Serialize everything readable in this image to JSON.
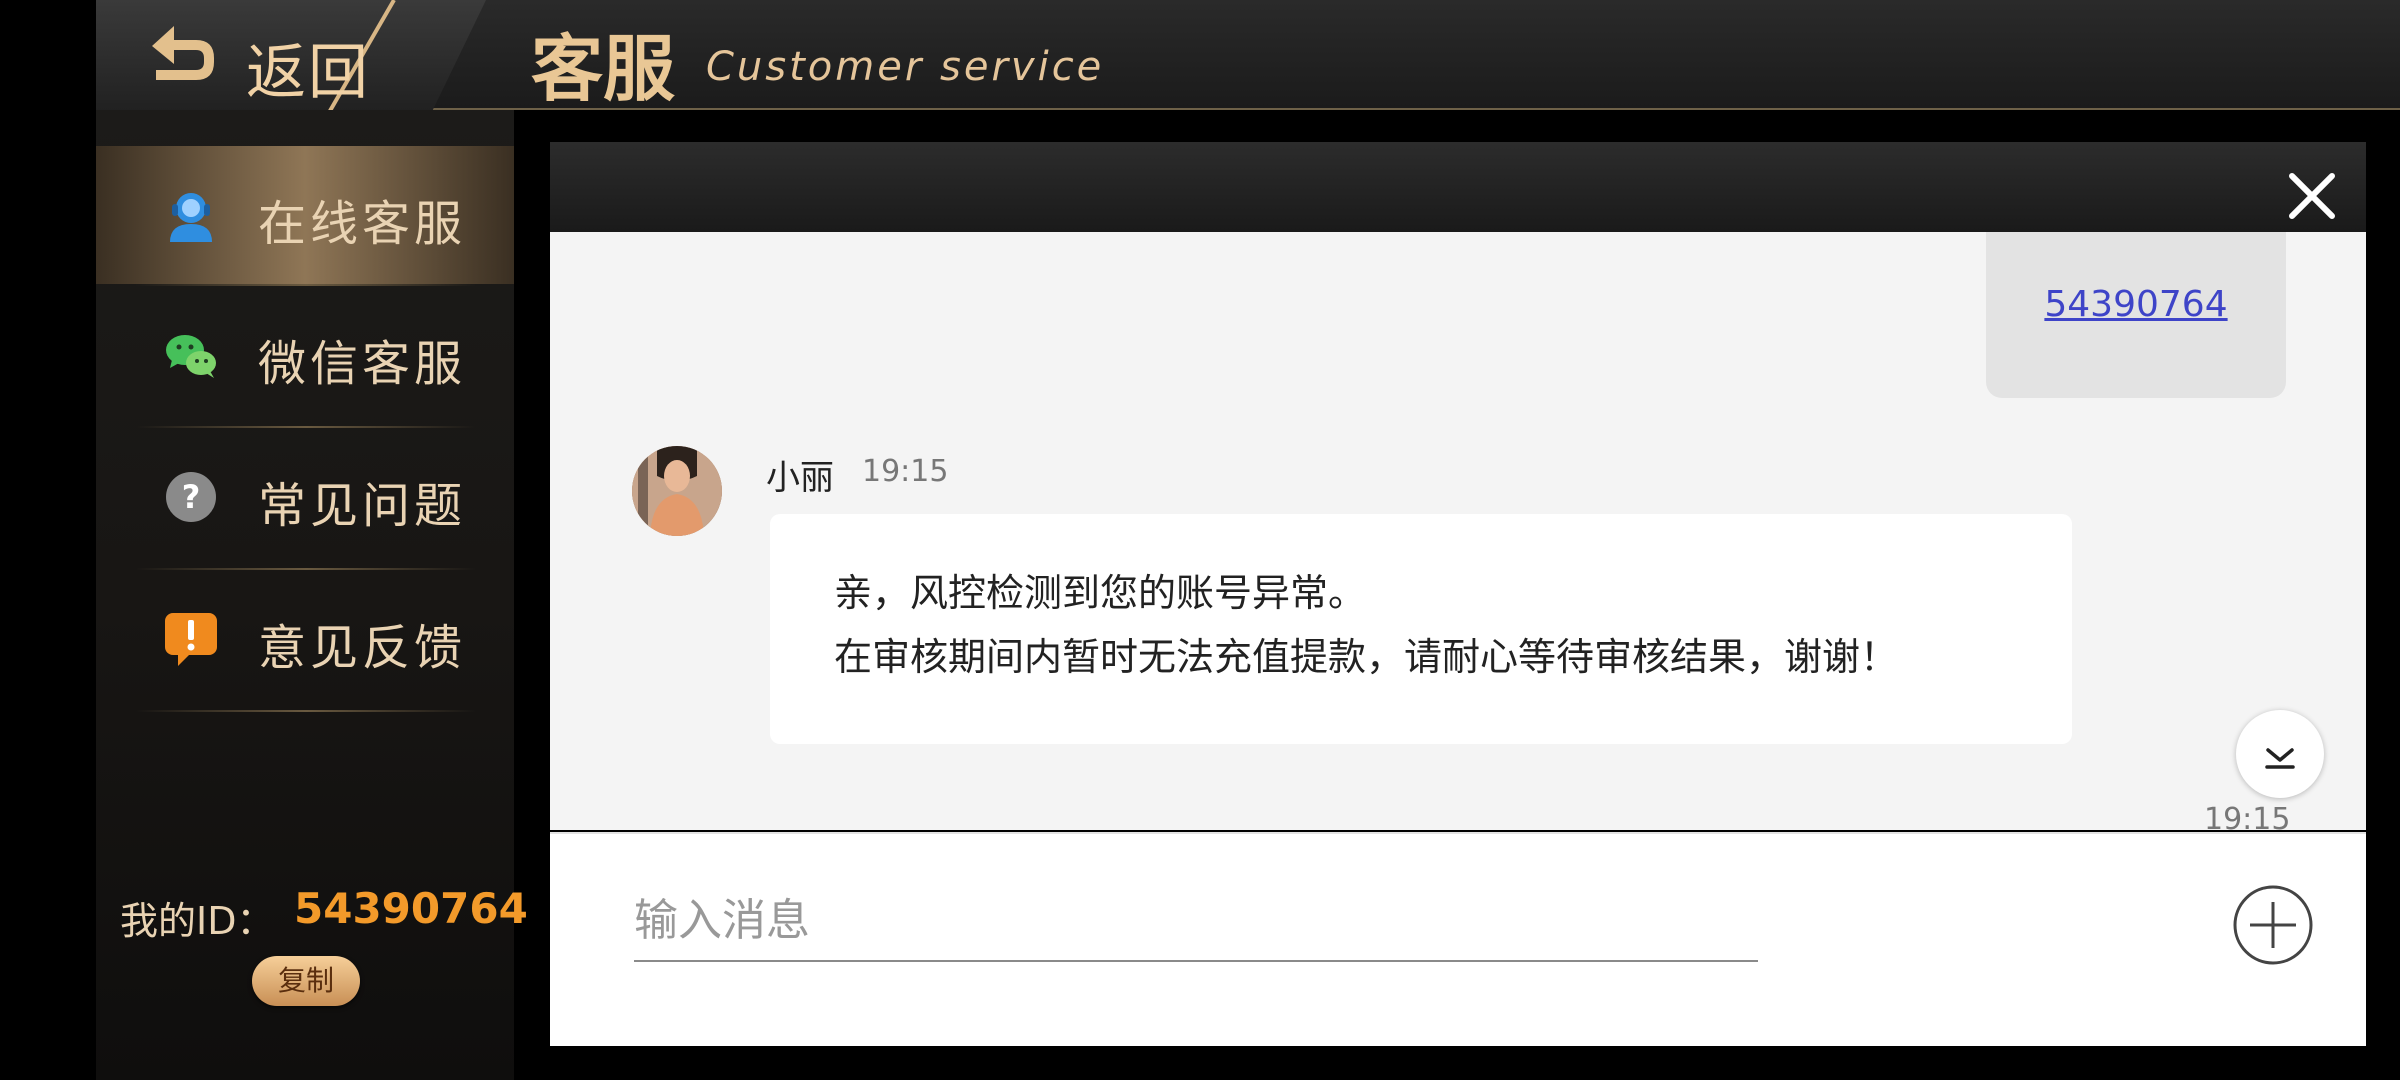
{
  "header": {
    "back_label": "返回",
    "title": "客服",
    "subtitle": "Customer service"
  },
  "sidebar": {
    "items": [
      {
        "label": "在线客服",
        "icon": "headset-user-icon",
        "active": true
      },
      {
        "label": "微信客服",
        "icon": "wechat-icon",
        "active": false
      },
      {
        "label": "常见问题",
        "icon": "question-icon",
        "active": false
      },
      {
        "label": "意见反馈",
        "icon": "feedback-alert-icon",
        "active": false
      }
    ],
    "my_id_label": "我的ID：",
    "my_id_value": "54390764",
    "copy_label": "复制"
  },
  "chat": {
    "my_message_link": "54390764",
    "agent": {
      "name": "小丽",
      "time": "19:15"
    },
    "agent_message": {
      "line1": "亲，风控检测到您的账号异常。",
      "line2": "在审核期间内暂时无法充值提款，请耐心等待审核结果，谢谢！"
    },
    "bottom_time": "19:15",
    "input_placeholder": "输入消息"
  },
  "colors": {
    "accent_gold": "#e9c795",
    "id_orange": "#f39a2a",
    "link_blue": "#3e44c8"
  }
}
